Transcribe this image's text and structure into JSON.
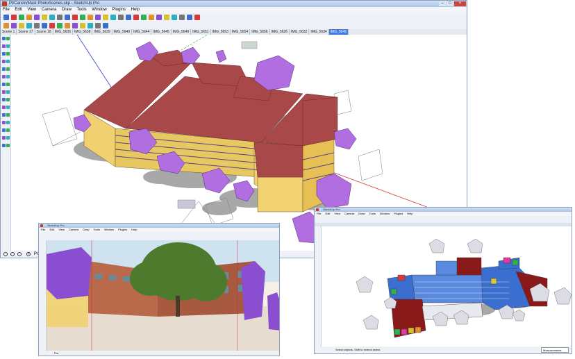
{
  "window_main": {
    "title": "Pt/Canon/Mast PhotoScenes.skp - SketchUp Pro",
    "controls": {
      "minimize": "–",
      "maximize": "□",
      "close": "×"
    },
    "menu": [
      "File",
      "Edit",
      "View",
      "Camera",
      "Draw",
      "Tools",
      "Window",
      "Plugins",
      "Help"
    ],
    "scene_tabs": [
      "Scene 1",
      "Scene 17",
      "Scene 18",
      "IMG_5635",
      "IMG_5638",
      "IMG_5639",
      "IMG_5640",
      "IMG_5644",
      "IMG_5645",
      "IMG_5649",
      "IMG_5651",
      "IMG_5653",
      "IMG_5654",
      "IMG_5656",
      "IMG_5626",
      "IMG_5632",
      "IMG_5634",
      "IMG_5646"
    ],
    "active_tab_index": 17,
    "status": {
      "help_icon": "?",
      "text": "Prs"
    }
  },
  "window_photo": {
    "title": "SketchUp Pro",
    "menu": [
      "File",
      "Edit",
      "View",
      "Camera",
      "Draw",
      "Tools",
      "Window",
      "Plugins",
      "Help"
    ],
    "status": {
      "text": "Prs"
    }
  },
  "window_colored": {
    "title": "SketchUp Pro",
    "menu": [
      "File",
      "Edit",
      "View",
      "Camera",
      "Draw",
      "Tools",
      "Window",
      "Plugins",
      "Help"
    ],
    "status": {
      "text": "Select objects. Shift to extend select.",
      "measurements_label": "Measurements"
    }
  },
  "colors": {
    "roof": "#a84848",
    "wall": "#f0d070",
    "camera_frustum": "#b16ee0",
    "tab_active": "#3d7be0",
    "titlebar": "#a9c4e6"
  },
  "icons": {
    "toolbar": [
      "select",
      "eraser",
      "paint",
      "line",
      "rectangle",
      "circle",
      "arc",
      "push-pull",
      "move",
      "rotate",
      "scale",
      "offset",
      "tape",
      "protractor",
      "text",
      "axes",
      "orbit",
      "pan",
      "zoom",
      "zoom-extents",
      "section",
      "camera",
      "walk",
      "look-around"
    ],
    "status": [
      "geo-location-icon",
      "credits-icon",
      "user-icon",
      "help-icon"
    ]
  }
}
